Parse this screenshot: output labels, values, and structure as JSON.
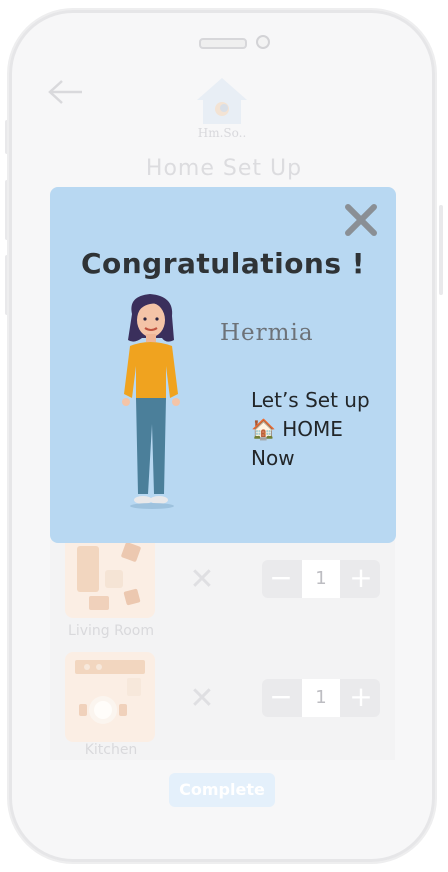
{
  "header": {
    "logo_text": "Hm.So..",
    "title": "Home Set Up"
  },
  "rooms": [
    {
      "label": "Living Room",
      "quantity": "1",
      "minus": "−",
      "plus": "+",
      "remove": "✕"
    },
    {
      "label": "Kitchen",
      "quantity": "1",
      "minus": "−",
      "plus": "+",
      "remove": "✕"
    }
  ],
  "footer": {
    "complete_label": "Complete"
  },
  "modal": {
    "title": "Congratulations !",
    "name": "Hermia",
    "message_line1": "Let’s Set up",
    "message_line2": "🏠 HOME",
    "message_line3": "Now"
  },
  "colors": {
    "modal_bg": "#b8d8f2",
    "phone_bg": "#f7f7f8"
  }
}
